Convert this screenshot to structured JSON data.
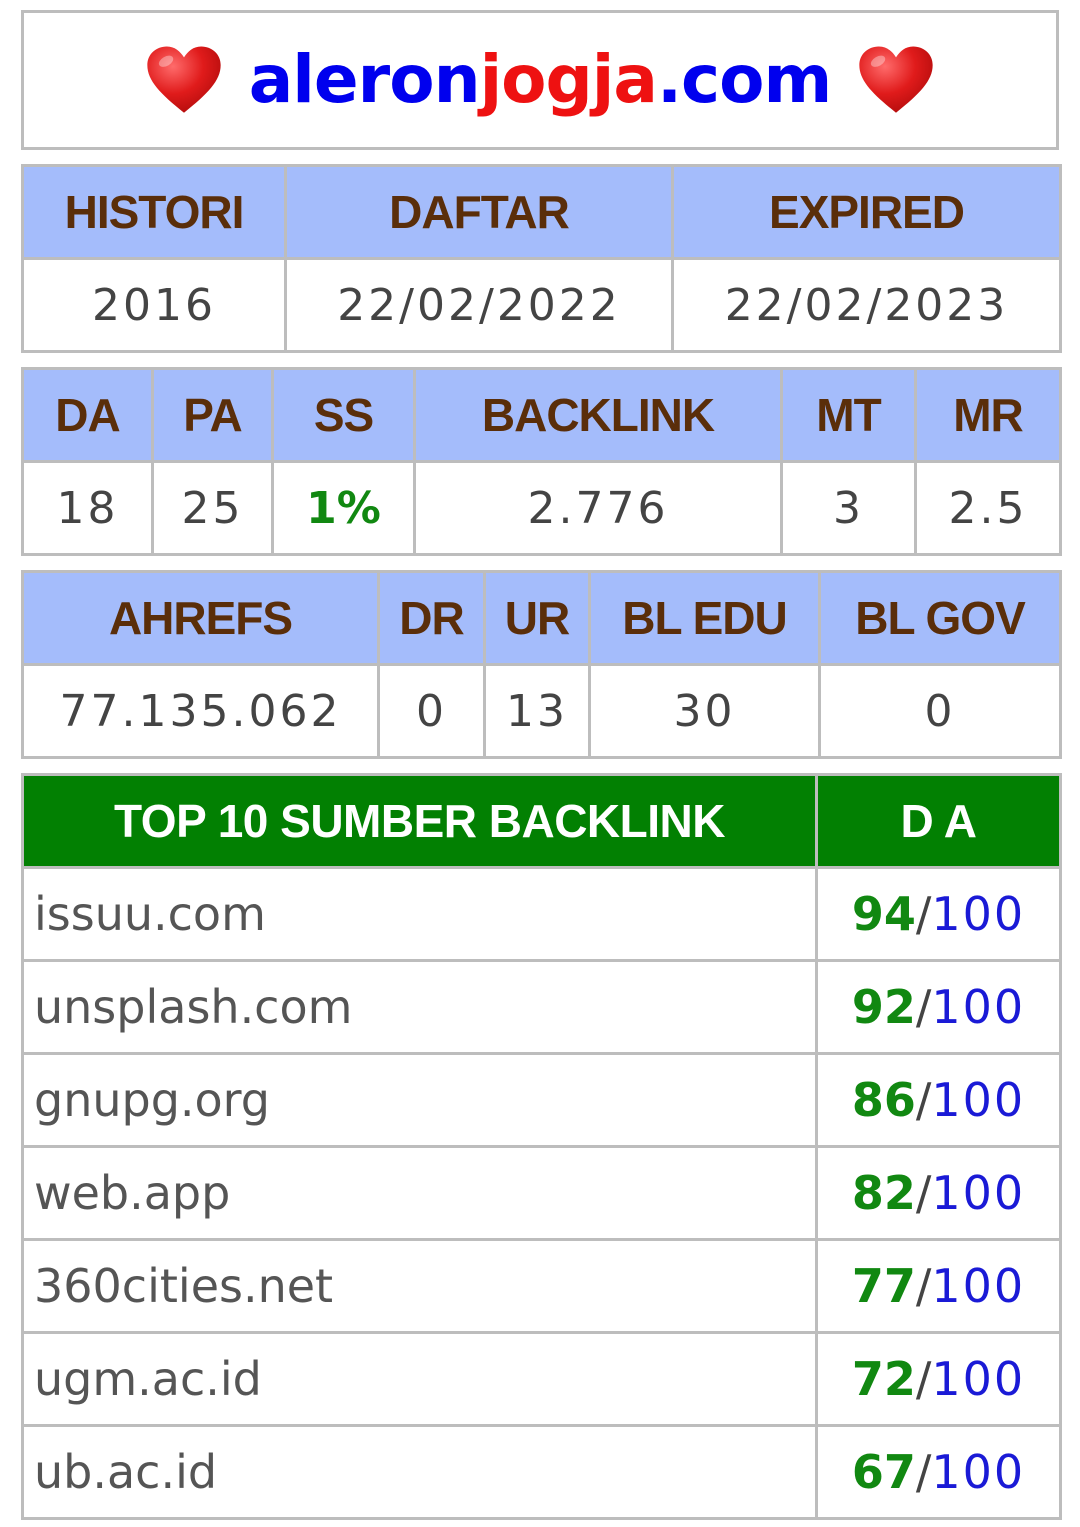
{
  "header": {
    "domain_part1": "aleron",
    "domain_part2": "jogja",
    "domain_part3": ".com",
    "left_icon": "heart-icon",
    "right_icon": "heart-icon"
  },
  "registration": {
    "headers": [
      "HISTORI",
      "DAFTAR",
      "EXPIRED"
    ],
    "values": [
      "2016",
      "22/02/2022",
      "22/02/2023"
    ]
  },
  "moz": {
    "headers": [
      "DA",
      "PA",
      "SS",
      "BACKLINK",
      "MT",
      "MR"
    ],
    "values": [
      "18",
      "25",
      "1%",
      "2.776",
      "3",
      "2.5"
    ]
  },
  "ahrefs": {
    "headers": [
      "AHREFS",
      "DR",
      "UR",
      "BL EDU",
      "BL GOV"
    ],
    "values": [
      "77.135.062",
      "0",
      "13",
      "30",
      "0"
    ]
  },
  "top_backlinks": {
    "header_source": "TOP 10 SUMBER BACKLINK",
    "header_da": "D A",
    "max_label": "100",
    "separator": "/",
    "rows": [
      {
        "site": "issuu.com",
        "da": "94"
      },
      {
        "site": "unsplash.com",
        "da": "92"
      },
      {
        "site": "gnupg.org",
        "da": "86"
      },
      {
        "site": "web.app",
        "da": "82"
      },
      {
        "site": "360cities.net",
        "da": "77"
      },
      {
        "site": "ugm.ac.id",
        "da": "72"
      },
      {
        "site": "ub.ac.id",
        "da": "67"
      }
    ]
  },
  "colors": {
    "header_bg": "#a4bcfb",
    "header_text": "#5a2e0a",
    "top_header_bg": "#028002",
    "da_green": "#118811",
    "max_blue": "#1a1ad6",
    "domain_blue": "#0000ee",
    "domain_red": "#ee1111"
  }
}
